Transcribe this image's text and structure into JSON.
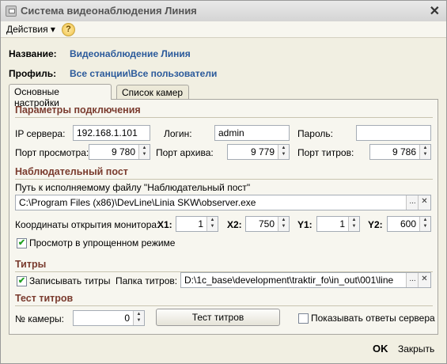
{
  "window": {
    "title": "Система видеонаблюдения Линия",
    "close_glyph": "✕"
  },
  "menu": {
    "actions_label": "Действия",
    "actions_arrow": "▾",
    "help_glyph": "?"
  },
  "info": {
    "name_label": "Название:",
    "name_value": "Видеонаблюдение Линия",
    "profile_label": "Профиль:",
    "profile_value": "Все станции\\Все пользователи"
  },
  "tabs": [
    {
      "label": "Основные настройки",
      "active": true
    },
    {
      "label": "Список камер",
      "active": false
    }
  ],
  "connection": {
    "section": "Параметры подключения",
    "ip_label": "IP сервера:",
    "ip_value": "192.168.1.101",
    "login_label": "Логин:",
    "login_value": "admin",
    "password_label": "Пароль:",
    "password_value": "",
    "view_port_label": "Порт просмотра:",
    "view_port_value": "9 780",
    "archive_port_label": "Порт архива:",
    "archive_port_value": "9 779",
    "titles_port_label": "Порт титров:",
    "titles_port_value": "9 786"
  },
  "post": {
    "section": "Наблюдательный пост",
    "path_label": "Путь к исполняемому файлу \"Наблюдательный пост\"",
    "path_value": "C:\\Program Files (x86)\\DevLine\\Linia SKW\\observer.exe",
    "monitor_label": "Координаты открытия монитора:",
    "x1_label": "X1:",
    "x1_value": "1",
    "x2_label": "X2:",
    "x2_value": "750",
    "y1_label": "Y1:",
    "y1_value": "1",
    "y2_label": "Y2:",
    "y2_value": "600",
    "simple_view_label": "Просмотр в упрощенном режиме",
    "simple_view_checked": true
  },
  "titles": {
    "section": "Титры",
    "record_label": "Записывать титры",
    "record_checked": true,
    "folder_label": "Папка титров:",
    "folder_value": "D:\\1c_base\\development\\traktir_fo\\in_out\\001\\line"
  },
  "test": {
    "section": "Тест титров",
    "camera_label": "№ камеры:",
    "camera_value": "0",
    "test_button": "Тест титров",
    "show_answers_label": "Показывать ответы сервера",
    "show_answers_checked": false
  },
  "footer": {
    "ok": "OK",
    "close": "Закрыть"
  },
  "glyphs": {
    "spin": "▲▼",
    "ellipsis": "...",
    "clear": "✕",
    "check": "✔"
  },
  "colors": {
    "accent_text": "#2b5a9b",
    "section_text": "#7a3b2e"
  }
}
